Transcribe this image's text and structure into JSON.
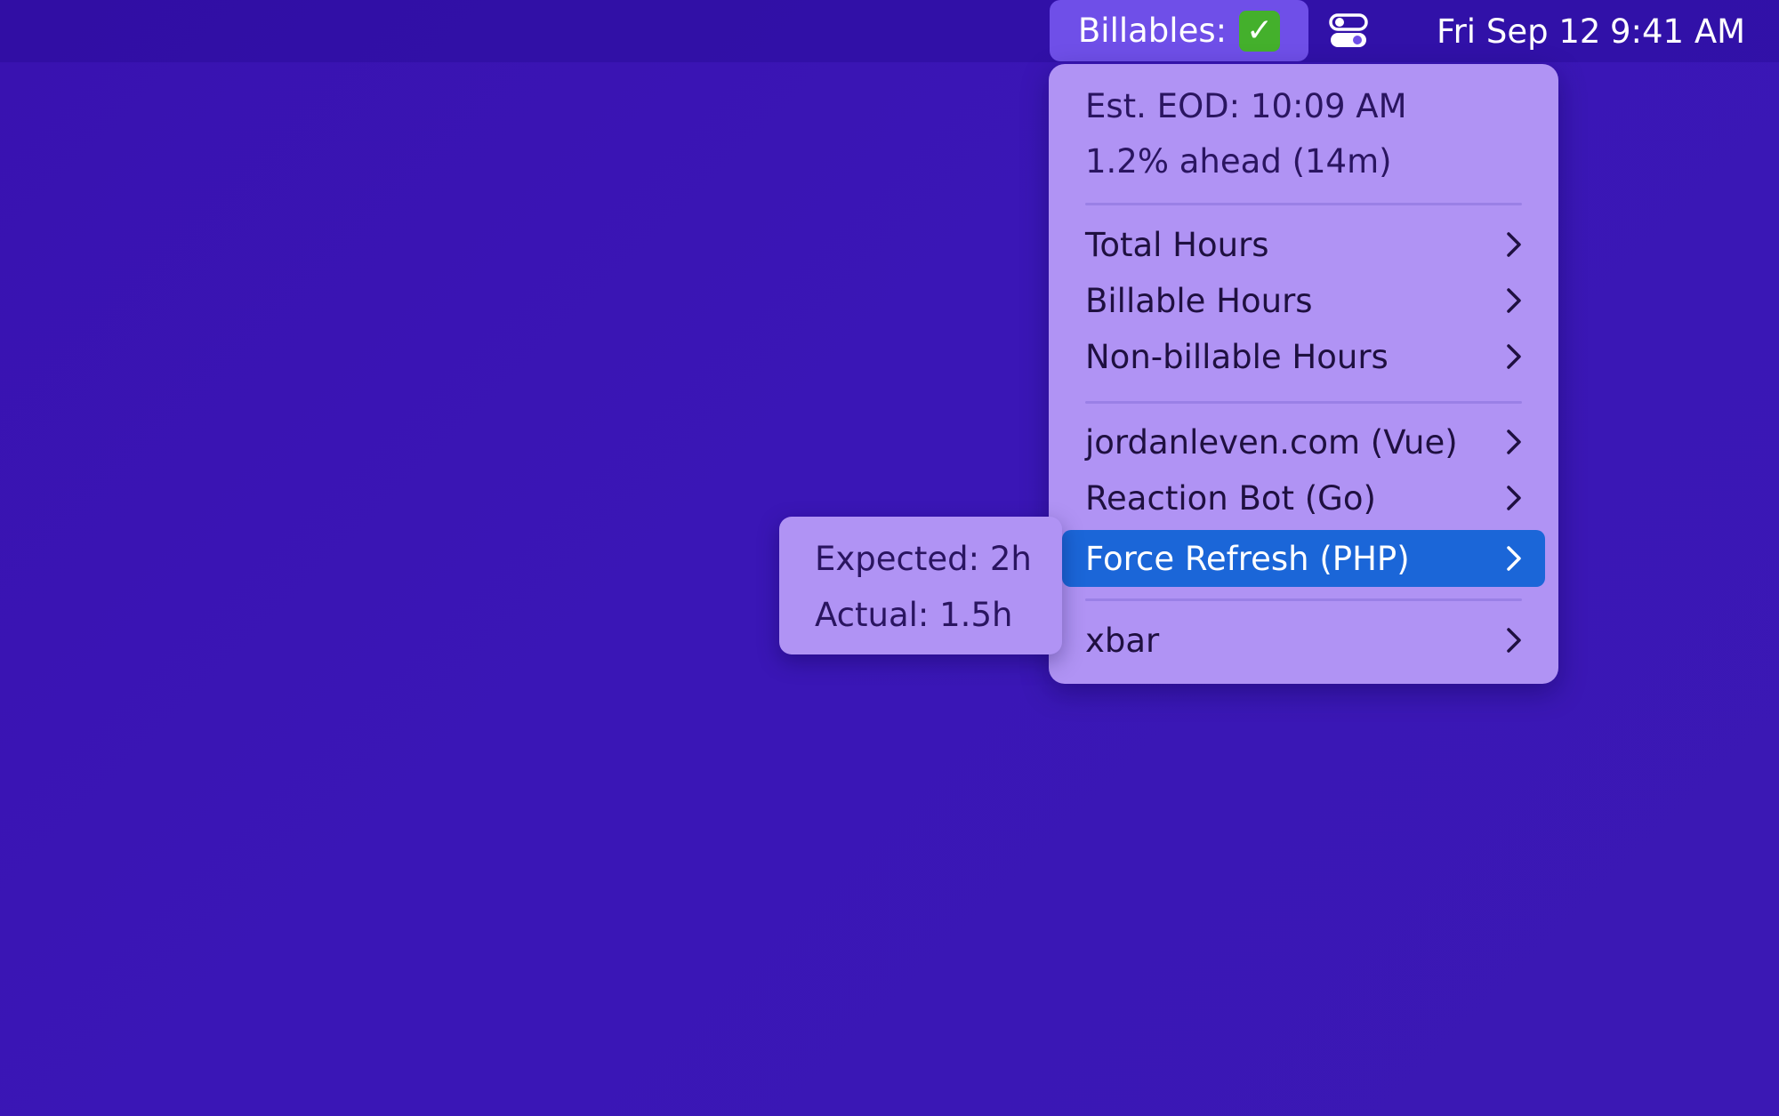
{
  "menubar": {
    "billables": {
      "label": "Billables:",
      "status_icon": "green-checkmark-icon",
      "status_color": "#44b02c",
      "check_glyph": "✓"
    },
    "control_center_icon": "toggle-switches-icon",
    "date": "Fri Sep 12",
    "time": "9:41 AM"
  },
  "menu": {
    "summary": {
      "eod": "Est. EOD: 10:09 AM",
      "pace": "1.2% ahead (14m)"
    },
    "hours_items": [
      {
        "label": "Total Hours"
      },
      {
        "label": "Billable Hours"
      },
      {
        "label": "Non-billable Hours"
      }
    ],
    "project_items": [
      {
        "label": "jordanleven.com (Vue)"
      },
      {
        "label": "Reaction Bot (Go)"
      },
      {
        "label": "Force Refresh (PHP)",
        "highlighted": true
      }
    ],
    "app_items": [
      {
        "label": "xbar"
      }
    ]
  },
  "submenu": {
    "expected": "Expected: 2h",
    "actual": "Actual: 1.5h"
  },
  "colors": {
    "desktop": "#3a16b6",
    "menu_background": "#b093f4",
    "highlight": "#1b66d8",
    "menubar_active_item": "#6f4fe8"
  }
}
